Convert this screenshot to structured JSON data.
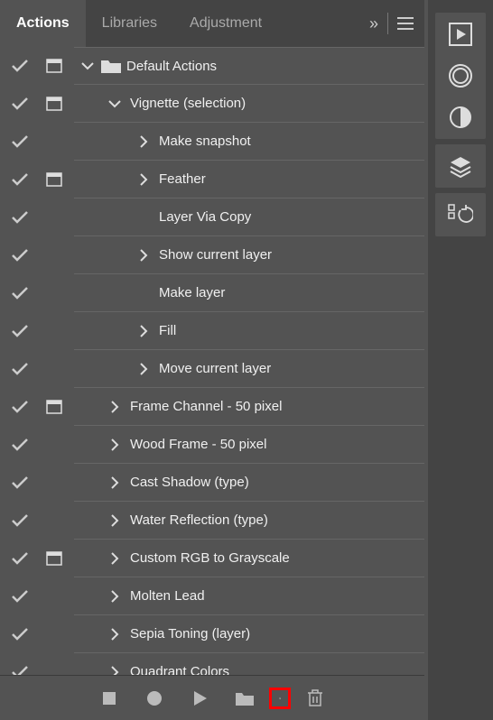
{
  "tabs": {
    "active": "Actions",
    "items": [
      "Actions",
      "Libraries",
      "Adjustment"
    ]
  },
  "tree": [
    {
      "level": 1,
      "check": true,
      "dialog": "square",
      "disclosure": "down",
      "folder": true,
      "label": "Default Actions"
    },
    {
      "level": 2,
      "check": true,
      "dialog": "square",
      "disclosure": "down",
      "label": "Vignette (selection)"
    },
    {
      "level": 3,
      "check": true,
      "dialog": "none",
      "disclosure": "right",
      "label": "Make snapshot"
    },
    {
      "level": 3,
      "check": true,
      "dialog": "square",
      "disclosure": "right",
      "label": "Feather"
    },
    {
      "level": 3,
      "check": true,
      "dialog": "none",
      "disclosure": "none",
      "label": "Layer Via Copy"
    },
    {
      "level": 3,
      "check": true,
      "dialog": "none",
      "disclosure": "right",
      "label": "Show current layer"
    },
    {
      "level": 3,
      "check": true,
      "dialog": "none",
      "disclosure": "none",
      "label": "Make layer"
    },
    {
      "level": 3,
      "check": true,
      "dialog": "none",
      "disclosure": "right",
      "label": "Fill"
    },
    {
      "level": 3,
      "check": true,
      "dialog": "none",
      "disclosure": "right",
      "label": "Move current layer"
    },
    {
      "level": 2,
      "check": true,
      "dialog": "square",
      "disclosure": "right",
      "label": "Frame Channel - 50 pixel"
    },
    {
      "level": 2,
      "check": true,
      "dialog": "none",
      "disclosure": "right",
      "label": "Wood Frame - 50 pixel"
    },
    {
      "level": 2,
      "check": true,
      "dialog": "none",
      "disclosure": "right",
      "label": "Cast Shadow (type)"
    },
    {
      "level": 2,
      "check": true,
      "dialog": "none",
      "disclosure": "right",
      "label": "Water Reflection (type)"
    },
    {
      "level": 2,
      "check": true,
      "dialog": "square",
      "disclosure": "right",
      "label": "Custom RGB to Grayscale"
    },
    {
      "level": 2,
      "check": true,
      "dialog": "none",
      "disclosure": "right",
      "label": "Molten Lead"
    },
    {
      "level": 2,
      "check": true,
      "dialog": "none",
      "disclosure": "right",
      "label": "Sepia Toning (layer)"
    },
    {
      "level": 2,
      "check": true,
      "dialog": "none",
      "disclosure": "right",
      "label": "Quadrant Colors"
    }
  ],
  "bottom": {
    "stop": "Stop",
    "record": "Record",
    "play": "Play",
    "new_set": "New Set",
    "new_action": "New Action",
    "delete": "Delete"
  },
  "dock": {
    "play": "Play",
    "cc": "Creative Cloud",
    "adjust": "Adjustments",
    "layers": "Layers",
    "history": "History"
  }
}
